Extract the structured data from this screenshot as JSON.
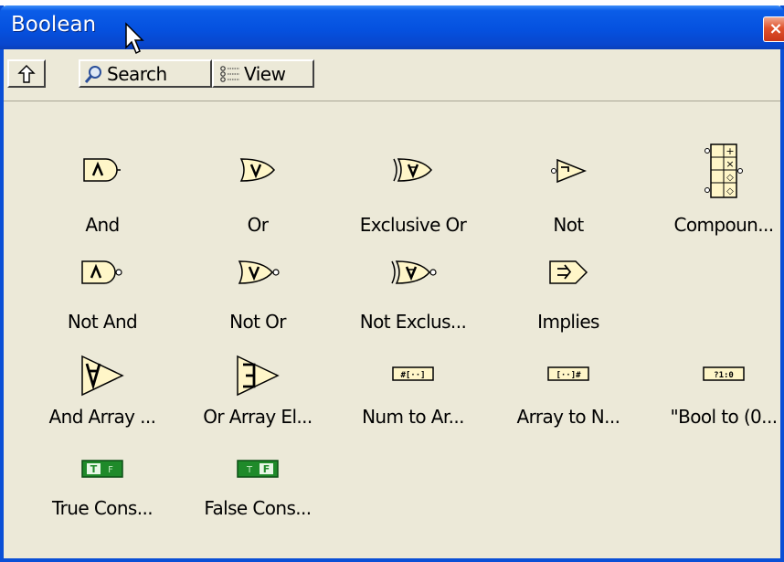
{
  "window": {
    "title": "Boolean",
    "close_label": "×"
  },
  "toolbar": {
    "up_icon": "arrow-up-icon",
    "search_label": "Search",
    "view_label": "View"
  },
  "palette": {
    "items": [
      {
        "label": "And",
        "icon": "and-gate-icon"
      },
      {
        "label": "Or",
        "icon": "or-gate-icon"
      },
      {
        "label": "Exclusive Or",
        "icon": "xor-gate-icon"
      },
      {
        "label": "Not",
        "icon": "not-gate-icon"
      },
      {
        "label": "Compoun...",
        "icon": "compound-arithmetic-icon"
      },
      {
        "label": "Not And",
        "icon": "nand-gate-icon"
      },
      {
        "label": "Not Or",
        "icon": "nor-gate-icon"
      },
      {
        "label": "Not Exclus...",
        "icon": "xnor-gate-icon"
      },
      {
        "label": "Implies",
        "icon": "implies-icon"
      },
      {
        "label": "And Array ...",
        "icon": "and-array-icon"
      },
      {
        "label": "Or Array El...",
        "icon": "or-array-icon"
      },
      {
        "label": "Num to Ar...",
        "icon": "num-to-array-icon"
      },
      {
        "label": "Array to N...",
        "icon": "array-to-num-icon"
      },
      {
        "label": "\"Bool to (0...",
        "icon": "bool-to-01-icon"
      },
      {
        "label": "True Cons...",
        "icon": "true-constant-icon"
      },
      {
        "label": "False Cons...",
        "icon": "false-constant-icon"
      }
    ]
  },
  "colors": {
    "titlebar": "#0551df",
    "window_bg": "#ece9d8",
    "icon_fill": "#fff6c8",
    "constant_green": "#1f8a2a"
  }
}
